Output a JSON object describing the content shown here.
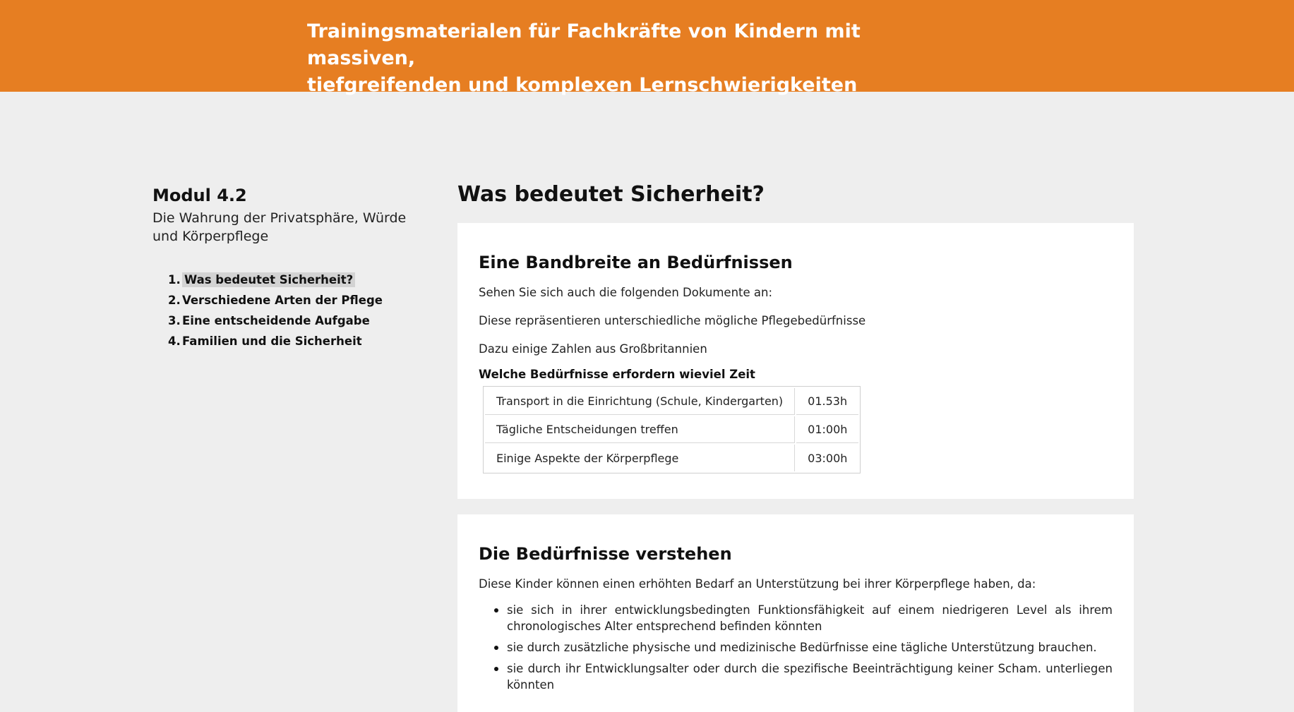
{
  "banner": {
    "title_line1": "Trainingsmaterialen für Fachkräfte von Kindern mit massiven,",
    "title_line2": "tiefgreifenden und komplexen Lernschwierigkeiten",
    "color": "#e67e22"
  },
  "sidebar": {
    "module_title": "Modul 4.2",
    "module_subtitle": "Die Wahrung der Privatsphäre, Würde und Körperpflege",
    "toc": [
      {
        "num": "1.",
        "label": "Was bedeutet Sicherheit?",
        "active": true
      },
      {
        "num": "2.",
        "label": "Verschiedene Arten der Pflege",
        "active": false
      },
      {
        "num": "3.",
        "label": "Eine entscheidende Aufgabe",
        "active": false
      },
      {
        "num": "4.",
        "label": "Familien und die Sicherheit",
        "active": false
      }
    ]
  },
  "main": {
    "page_heading": "Was bedeutet Sicherheit?",
    "section1": {
      "heading": "Eine Bandbreite an Bedürfnissen",
      "para1": "Sehen Sie sich auch die folgenden Dokumente an:",
      "para2": "Diese repräsentieren unterschiedliche mögliche Pflegebedürfnisse",
      "para3": "Dazu einige Zahlen aus Großbritannien",
      "table_caption": "Welche Bedürfnisse erfordern wieviel Zeit",
      "table_rows": [
        {
          "activity": "Transport in die Einrichtung (Schule, Kindergarten)",
          "time": "01.53h"
        },
        {
          "activity": "Tägliche Entscheidungen treffen",
          "time": "01:00h"
        },
        {
          "activity": "Einige Aspekte der Körperpflege",
          "time": "03:00h"
        }
      ]
    },
    "section2": {
      "heading": "Die Bedürfnisse verstehen",
      "intro": "Diese Kinder können einen erhöhten Bedarf an Unterstützung bei ihrer Körperpflege haben, da:",
      "bullets": [
        "sie sich in ihrer entwicklungsbedingten Funktionsfähigkeit auf einem niedrigeren Level als ihrem chronologisches Alter entsprechend befinden könnten",
        "sie durch zusätzliche physische und medizinische Bedürfnisse eine tägliche Unterstützung brauchen.",
        "sie durch ihr Entwicklungsalter oder durch die spezifische Beeinträchtigung keiner Scham. unterliegen könnten"
      ]
    }
  }
}
